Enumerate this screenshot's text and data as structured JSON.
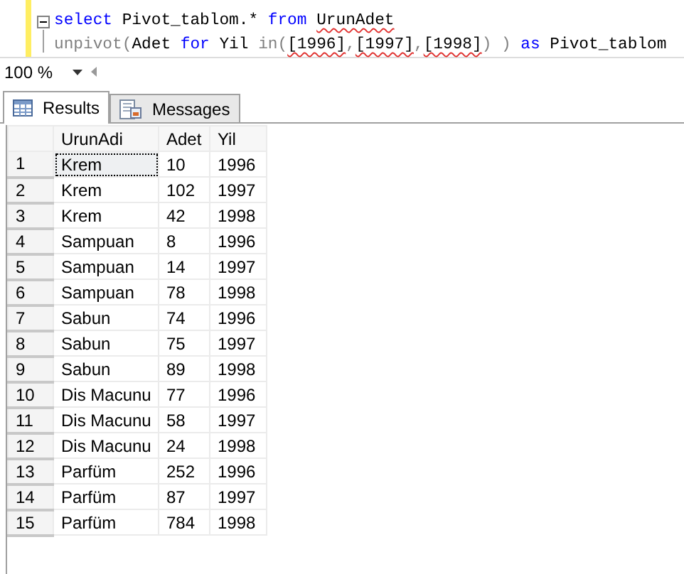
{
  "editor": {
    "lines": [
      [
        {
          "text": "select",
          "kind": "keyword"
        },
        {
          "text": " Pivot_tablom.* ",
          "kind": "plain"
        },
        {
          "text": "from ",
          "kind": "keyword"
        },
        {
          "text": "UrunAdet",
          "kind": "error"
        }
      ],
      [
        {
          "text": "unpivot(",
          "kind": "function"
        },
        {
          "text": "Adet ",
          "kind": "plain"
        },
        {
          "text": "for",
          "kind": "keyword"
        },
        {
          "text": " Yil ",
          "kind": "plain"
        },
        {
          "text": "in(",
          "kind": "function"
        },
        {
          "text": "[1996]",
          "kind": "error"
        },
        {
          "text": ",",
          "kind": "function"
        },
        {
          "text": "[1997]",
          "kind": "error"
        },
        {
          "text": ",",
          "kind": "function"
        },
        {
          "text": "[1998]",
          "kind": "error"
        },
        {
          "text": ") ) ",
          "kind": "function"
        },
        {
          "text": "as",
          "kind": "keyword"
        },
        {
          "text": " Pivot_tablom",
          "kind": "plain"
        }
      ]
    ]
  },
  "zoom": {
    "value": "100 %"
  },
  "tabs": [
    {
      "label": "Results",
      "selected": true
    },
    {
      "label": "Messages",
      "selected": false
    }
  ],
  "table": {
    "columns": [
      "UrunAdi",
      "Adet",
      "Yil"
    ],
    "rows": [
      {
        "number": "1",
        "cells": [
          "Krem",
          "10",
          "1996"
        ],
        "selected": true
      },
      {
        "number": "2",
        "cells": [
          "Krem",
          "102",
          "1997"
        ],
        "selected": false
      },
      {
        "number": "3",
        "cells": [
          "Krem",
          "42",
          "1998"
        ],
        "selected": false
      },
      {
        "number": "4",
        "cells": [
          "Sampuan",
          "8",
          "1996"
        ],
        "selected": false
      },
      {
        "number": "5",
        "cells": [
          "Sampuan",
          "14",
          "1997"
        ],
        "selected": false
      },
      {
        "number": "6",
        "cells": [
          "Sampuan",
          "78",
          "1998"
        ],
        "selected": false
      },
      {
        "number": "7",
        "cells": [
          "Sabun",
          "74",
          "1996"
        ],
        "selected": false
      },
      {
        "number": "8",
        "cells": [
          "Sabun",
          "75",
          "1997"
        ],
        "selected": false
      },
      {
        "number": "9",
        "cells": [
          "Sabun",
          "89",
          "1998"
        ],
        "selected": false
      },
      {
        "number": "10",
        "cells": [
          "Dis Macunu",
          "77",
          "1996"
        ],
        "selected": false
      },
      {
        "number": "11",
        "cells": [
          "Dis Macunu",
          "58",
          "1997"
        ],
        "selected": false
      },
      {
        "number": "12",
        "cells": [
          "Dis Macunu",
          "24",
          "1998"
        ],
        "selected": false
      },
      {
        "number": "13",
        "cells": [
          "Parfüm",
          "252",
          "1996"
        ],
        "selected": false
      },
      {
        "number": "14",
        "cells": [
          "Parfüm",
          "87",
          "1997"
        ],
        "selected": false
      },
      {
        "number": "15",
        "cells": [
          "Parfüm",
          "784",
          "1998"
        ],
        "selected": false
      }
    ]
  }
}
